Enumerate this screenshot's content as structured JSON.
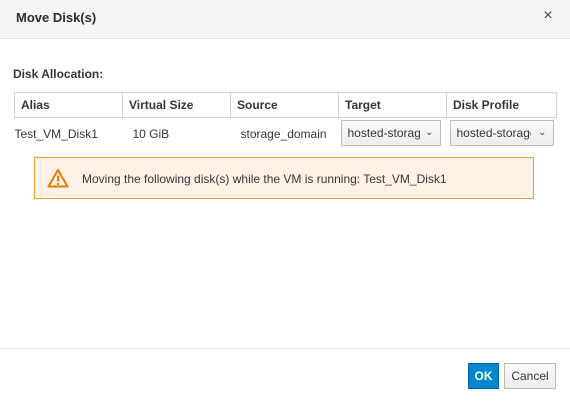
{
  "dialog": {
    "title": "Move Disk(s)",
    "close_glyph": "×"
  },
  "section": {
    "label": "Disk Allocation:"
  },
  "table": {
    "headers": [
      "Alias",
      "Virtual Size",
      "Source",
      "Target",
      "Disk Profile"
    ],
    "rows": [
      {
        "alias": "Test_VM_Disk1",
        "virtual_size": "10 GiB",
        "source": "storage_domain",
        "target": "hosted-storage",
        "disk_profile": "hosted-storage"
      }
    ]
  },
  "alert": {
    "icon": "warning-triangle-icon",
    "message": "Moving the following disk(s) while the VM is running: Test_VM_Disk1",
    "border_color": "#ec9c3c",
    "background_color": "#fdf2e5"
  },
  "footer": {
    "ok_label": "OK",
    "cancel_label": "Cancel",
    "primary_color": "#0088ce"
  }
}
